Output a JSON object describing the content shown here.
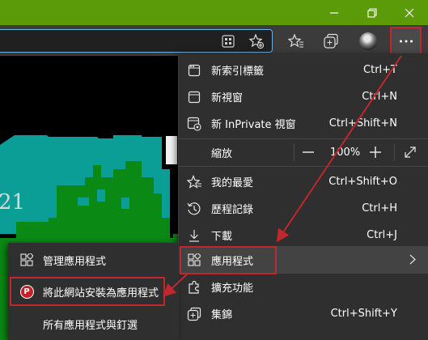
{
  "window": {
    "minimize_icon": "minimize-icon",
    "restore_icon": "restore-icon",
    "close_icon": "close-icon",
    "titlebar_color": "#5b9a08"
  },
  "toolbar": {
    "icons": [
      "apps-grid-icon",
      "add-favorite-icon",
      "favorites-icon",
      "collections-icon",
      "profile-avatar",
      "more-icon"
    ]
  },
  "page": {
    "visible_text": "21"
  },
  "menu": {
    "new_tab": {
      "label": "新索引標籤",
      "shortcut": "Ctrl+T"
    },
    "new_window": {
      "label": "新視窗",
      "shortcut": "Ctrl+N"
    },
    "new_inprivate": {
      "label": "新 InPrivate 視窗",
      "shortcut": "Ctrl+Shift+N"
    },
    "zoom": {
      "label": "縮放",
      "minus": "—",
      "value": "100%",
      "plus": "+"
    },
    "favorites": {
      "label": "我的最愛",
      "shortcut": "Ctrl+Shift+O"
    },
    "history": {
      "label": "歷程記錄",
      "shortcut": "Ctrl+H"
    },
    "downloads": {
      "label": "下載",
      "shortcut": "Ctrl+J"
    },
    "apps": {
      "label": "應用程式"
    },
    "extensions": {
      "label": "擴充功能"
    },
    "collections": {
      "label": "集錦",
      "shortcut": "Ctrl+Shift+Y"
    }
  },
  "submenu": {
    "manage_apps": {
      "label": "管理應用程式"
    },
    "install_site": {
      "label": "將此網站安裝為應用程式",
      "logo_letter": "P"
    },
    "all_apps": {
      "label": "所有應用程式與釘選"
    }
  },
  "colors": {
    "highlight_red": "#c1272d",
    "menu_bg": "#2f2f2f",
    "menu_hover": "#434343",
    "teal": "#0b9e97",
    "green": "#0a8a14"
  }
}
